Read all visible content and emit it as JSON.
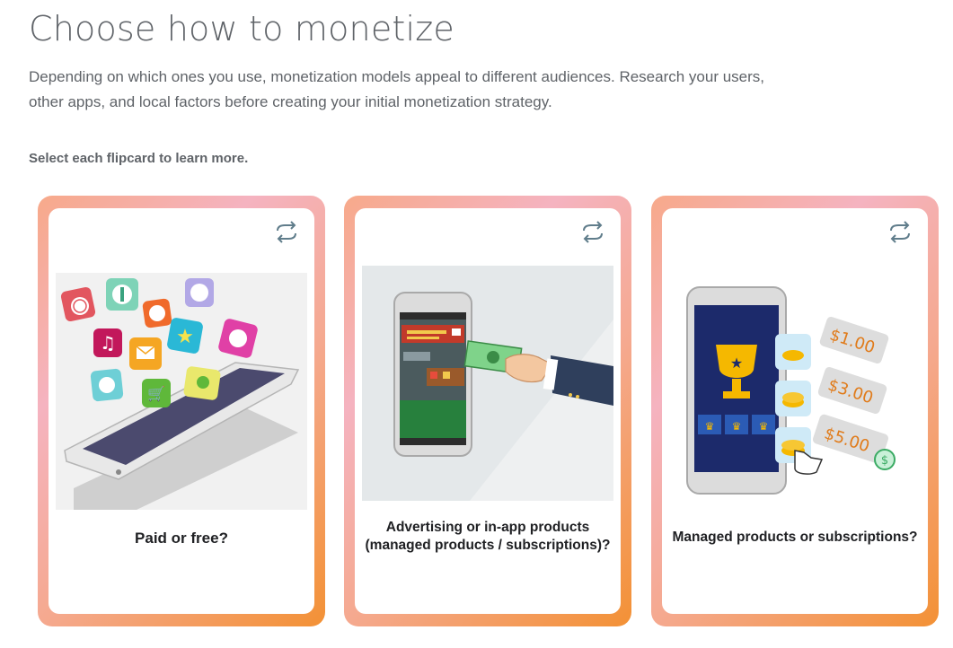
{
  "page": {
    "title": "Choose how to monetize",
    "intro_line1": "Depending on which ones you use, monetization models appeal to different audiences. Research your users,",
    "intro_line2": "other apps, and local factors before creating your initial monetization strategy.",
    "instruction": "Select each flipcard to learn more."
  },
  "cards": [
    {
      "label": "Paid or free?",
      "icon": "flip-icon",
      "image": "phone-with-app-icons"
    },
    {
      "label_line1": "Advertising or in-app products",
      "label_line2": "(managed products / subscriptions)?",
      "icon": "flip-icon",
      "image": "phone-with-cash-payment"
    },
    {
      "label": "Managed products or subscriptions?",
      "icon": "flip-icon",
      "image": "phone-with-price-tags"
    }
  ],
  "art": {
    "price1": "$1.00",
    "price2": "$3.00",
    "price3": "$5.00"
  },
  "colors": {
    "card_gradient_start": "#f7a98a",
    "card_gradient_pink": "#f5b3c0",
    "card_gradient_end": "#f39135",
    "title_gray": "#5f6368"
  }
}
